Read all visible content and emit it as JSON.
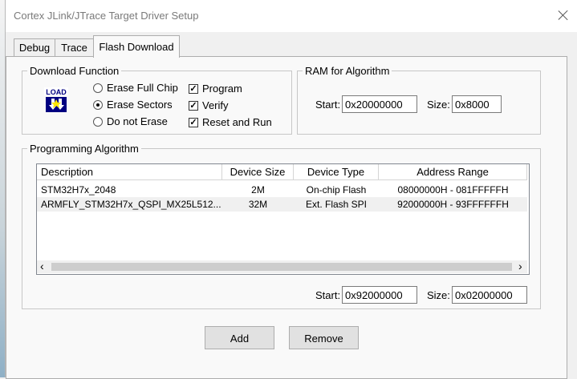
{
  "window": {
    "title": "Cortex JLink/JTrace Target Driver Setup"
  },
  "tabs": [
    {
      "label": "Debug",
      "active": false
    },
    {
      "label": "Trace",
      "active": false
    },
    {
      "label": "Flash Download",
      "active": true
    }
  ],
  "download_function": {
    "legend": "Download Function",
    "icon": "load-icon",
    "icon_text": "LOAD",
    "radios": [
      {
        "label": "Erase Full Chip",
        "checked": false
      },
      {
        "label": "Erase Sectors",
        "checked": true
      },
      {
        "label": "Do not Erase",
        "checked": false
      }
    ],
    "checkboxes": [
      {
        "label": "Program",
        "checked": true,
        "mark": "✓"
      },
      {
        "label": "Verify",
        "checked": true,
        "mark": "✓"
      },
      {
        "label": "Reset and Run",
        "checked": true,
        "mark": "✓"
      }
    ]
  },
  "ram": {
    "legend": "RAM for Algorithm",
    "start_label": "Start:",
    "start_value": "0x20000000",
    "size_label": "Size:",
    "size_value": "0x8000"
  },
  "programming": {
    "legend": "Programming Algorithm",
    "columns": [
      "Description",
      "Device Size",
      "Device Type",
      "Address Range"
    ],
    "rows": [
      {
        "description": "STM32H7x_2048",
        "size": "2M",
        "type": "On-chip Flash",
        "range": "08000000H - 081FFFFFH",
        "selected": false
      },
      {
        "description": "ARMFLY_STM32H7x_QSPI_MX25L512...",
        "size": "32M",
        "type": "Ext. Flash SPI",
        "range": "92000000H - 93FFFFFFH",
        "selected": true
      }
    ],
    "scroll_left": "‹",
    "scroll_right": "›",
    "start_label": "Start:",
    "start_value": "0x92000000",
    "size_label": "Size:",
    "size_value": "0x02000000"
  },
  "buttons": {
    "add": "Add",
    "remove": "Remove"
  }
}
